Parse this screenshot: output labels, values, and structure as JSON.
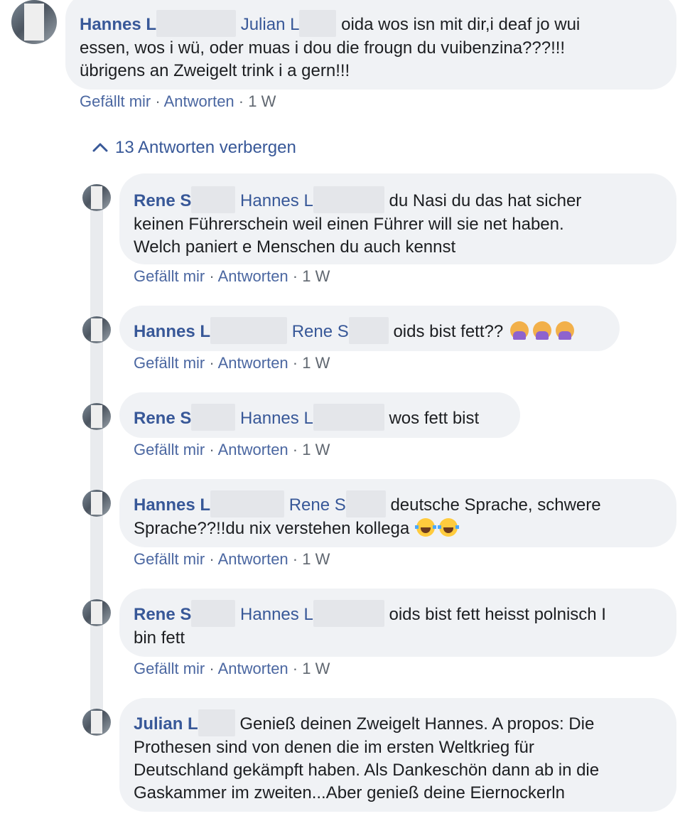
{
  "top_comment": {
    "author": "Hannes L",
    "mention": "Julian L",
    "text_line1": "oida wos isn mit dir,i deaf jo wui",
    "text_line2": "essen, wos i wü, oder muas i dou die frougn du vuibenzina???!!!",
    "text_line3": "übrigens an Zweigelt trink i a gern!!!",
    "like": "Gefällt mir",
    "reply": "Antworten",
    "time": "1 W"
  },
  "replies_toggle": "13 Antworten verbergen",
  "separator": "·",
  "replies": [
    {
      "author": "Rene S",
      "mention": "Hannes L",
      "line1": "du Nasi du das hat sicher",
      "line2": "keinen Führerschein weil einen Führer will sie net haben.",
      "line3": "Welch paniert e Menschen du auch kennst",
      "like": "Gefällt mir",
      "reply": "Antworten",
      "time": "1 W"
    },
    {
      "author": "Hannes L",
      "mention": "Rene S",
      "line1": "oids bist fett??",
      "emojis": [
        "woman-facepalming-emoji",
        "woman-facepalming-emoji",
        "woman-facepalming-emoji"
      ],
      "like": "Gefällt mir",
      "reply": "Antworten",
      "time": "1 W"
    },
    {
      "author": "Rene S",
      "mention": "Hannes L",
      "line1": "wos fett bist",
      "like": "Gefällt mir",
      "reply": "Antworten",
      "time": "1 W"
    },
    {
      "author": "Hannes L",
      "mention": "Rene S",
      "line1": "deutsche Sprache, schwere",
      "line2": "Sprache??!!du nix verstehen kollega",
      "emojis": [
        "tears-of-joy-emoji",
        "tears-of-joy-emoji"
      ],
      "like": "Gefällt mir",
      "reply": "Antworten",
      "time": "1 W"
    },
    {
      "author": "Rene S",
      "mention": "Hannes L",
      "line1": "oids bist fett heisst polnisch I",
      "line2": "bin fett",
      "like": "Gefällt mir",
      "reply": "Antworten",
      "time": "1 W"
    },
    {
      "author": "Julian L",
      "line1": "Genieß deinen Zweigelt Hannes. A propos: Die",
      "line2": "Prothesen sind von denen die im ersten Weltkrieg für",
      "line3": "Deutschland gekämpft haben. Als Dankeschön dann ab in die",
      "line4": "Gaskammer im zweiten...Aber genieß deine Eiernockerln"
    }
  ],
  "colors": {
    "link_blue": "#385898",
    "bubble_bg": "#f0f2f5",
    "meta_gray": "#606770"
  }
}
